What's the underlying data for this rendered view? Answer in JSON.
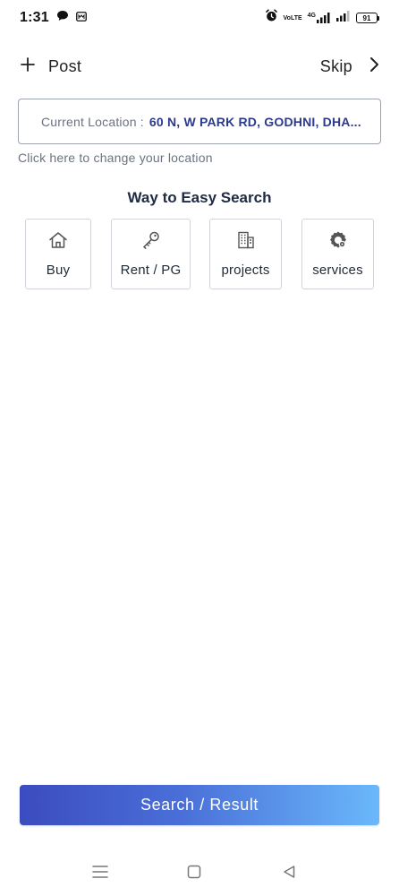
{
  "status_bar": {
    "time": "1:31",
    "network_label_top": "VoLTE",
    "network_gen": "4G",
    "battery": "91"
  },
  "top_bar": {
    "post_label": "Post",
    "skip_label": "Skip"
  },
  "location": {
    "label": "Current Location :",
    "value": "60 N, W PARK RD, GODHNI, DHA...",
    "change_hint": "Click here to change your location"
  },
  "search_section": {
    "title": "Way to Easy Search",
    "categories": [
      {
        "label": "Buy",
        "icon": "home-icon"
      },
      {
        "label": "Rent / PG",
        "icon": "key-icon"
      },
      {
        "label": "projects",
        "icon": "building-icon"
      },
      {
        "label": "services",
        "icon": "gear-icon"
      }
    ]
  },
  "search_button": {
    "label": "Search / Result"
  },
  "colors": {
    "accent_dark": "#3b4cc0",
    "accent_light": "#6ab8fb",
    "location_value": "#2d3a8c"
  }
}
